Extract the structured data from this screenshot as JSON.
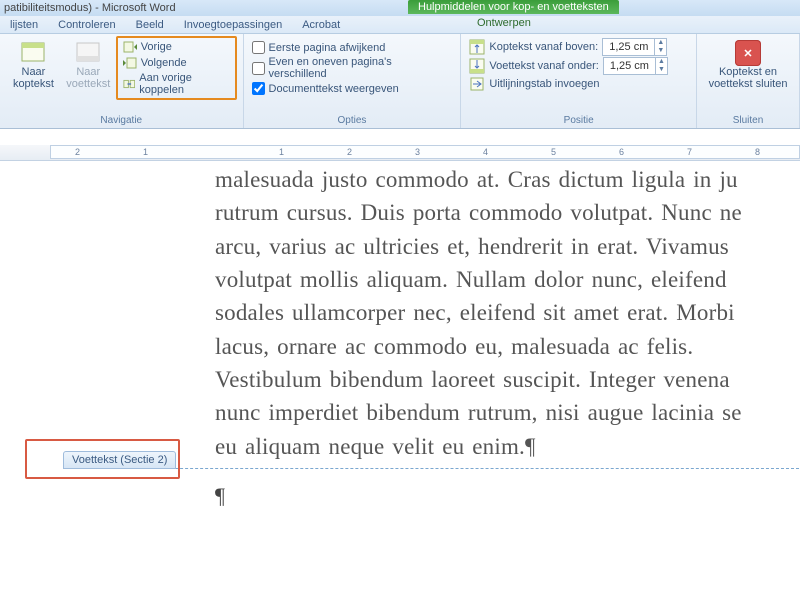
{
  "titlebar": "patibiliteitsmodus)  -  Microsoft Word",
  "context_tab_title": "Hulpmiddelen voor kop- en voetteksten",
  "tabs": {
    "t1": "lijsten",
    "t2": "Controleren",
    "t3": "Beeld",
    "t4": "Invoegtoepassingen",
    "t5": "Acrobat",
    "context": "Ontwerpen"
  },
  "navigatie": {
    "group_label": "Navigatie",
    "naar_koptekst": "Naar\nkoptekst",
    "naar_voettekst": "Naar\nvoettekst",
    "vorige": "Vorige",
    "volgende": "Volgende",
    "aan_vorige": "Aan vorige koppelen"
  },
  "opties": {
    "group_label": "Opties",
    "eerste_pagina": "Eerste pagina afwijkend",
    "even_oneven": "Even en oneven pagina's verschillend",
    "documenttekst": "Documenttekst weergeven"
  },
  "positie": {
    "group_label": "Positie",
    "koptekst_boven": "Koptekst vanaf boven:",
    "voettekst_onder": "Voettekst vanaf onder:",
    "uitlijningstab": "Uitlijningstab invoegen",
    "val1": "1,25 cm",
    "val2": "1,25 cm"
  },
  "sluiten": {
    "group_label": "Sluiten",
    "label": "Koptekst en\nvoettekst sluiten"
  },
  "ruler_numbers": [
    "2",
    "1",
    "1",
    "2",
    "3",
    "4",
    "5",
    "6",
    "7",
    "8"
  ],
  "document": {
    "body": "malesuada justo commodo at. Cras dictum ligula in ju\nrutrum cursus. Duis porta commodo volutpat. Nunc ne\narcu, varius ac ultricies et, hendrerit in erat. Vivamus \nvolutpat mollis aliquam. Nullam dolor nunc, eleifend \nsodales ullamcorper nec, eleifend sit amet erat. Morbi\nlacus, ornare ac commodo eu, malesuada ac felis. \nVestibulum bibendum laoreet suscipit. Integer venena\nnunc imperdiet bibendum rutrum, nisi augue lacinia se\neu aliquam neque velit eu enim.¶",
    "footer_tab": "Voettekst (Sectie 2)"
  }
}
